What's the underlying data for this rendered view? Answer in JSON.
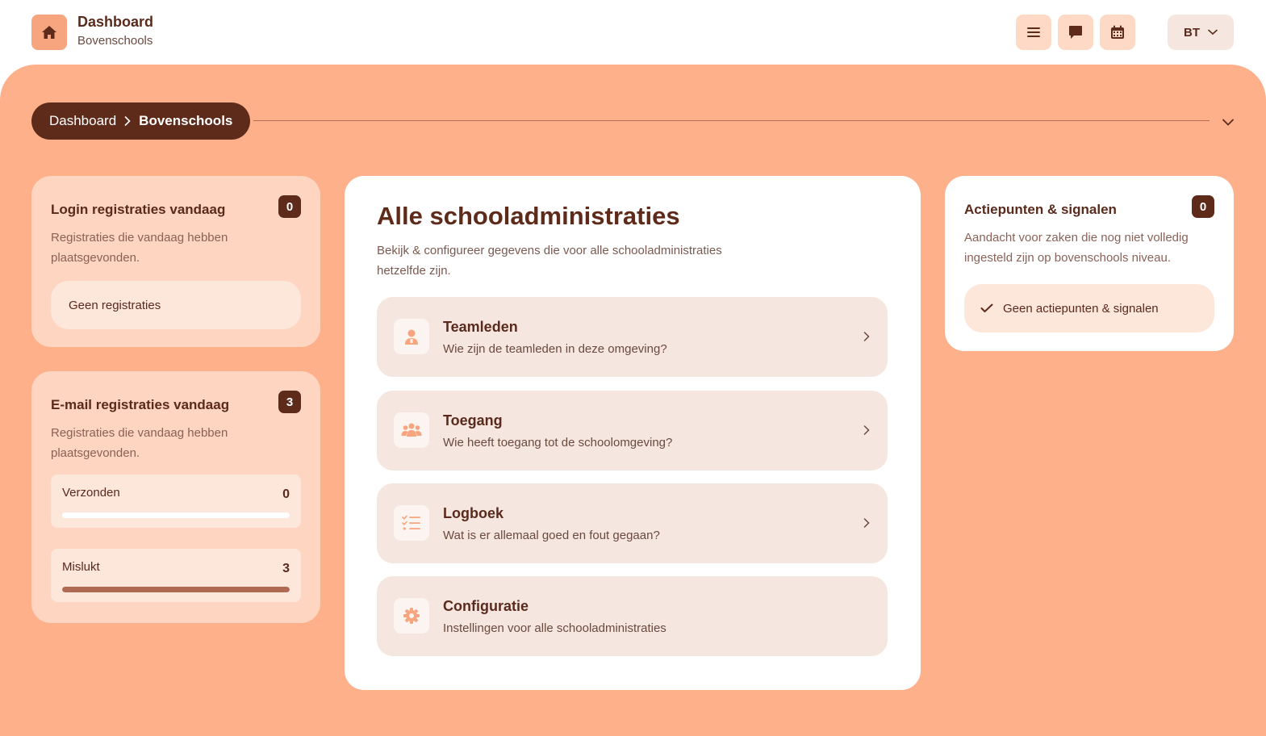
{
  "header": {
    "title": "Dashboard",
    "subtitle": "Bovenschools",
    "user_initials": "BT"
  },
  "breadcrumb": {
    "items": [
      "Dashboard",
      "Bovenschools"
    ]
  },
  "login_card": {
    "title": "Login registraties vandaag",
    "count": "0",
    "description": "Registraties die vandaag hebben plaatsgevonden.",
    "empty_text": "Geen registraties"
  },
  "email_card": {
    "title": "E-mail registraties vandaag",
    "count": "3",
    "description": "Registraties die vandaag hebben plaatsgevonden.",
    "stats": [
      {
        "label": "Verzonden",
        "value": "0",
        "fraction": 0
      },
      {
        "label": "Mislukt",
        "value": "3",
        "fraction": 1
      }
    ]
  },
  "main": {
    "title": "Alle schooladministraties",
    "description": "Bekijk & configureer gegevens die voor alle schooladministraties hetzelfde zijn.",
    "items": [
      {
        "title": "Teamleden",
        "subtitle": "Wie zijn de teamleden in deze omgeving?",
        "icon": "person-icon"
      },
      {
        "title": "Toegang",
        "subtitle": "Wie heeft toegang tot de schoolomgeving?",
        "icon": "users-icon"
      },
      {
        "title": "Logboek",
        "subtitle": "Wat is er allemaal goed en fout gegaan?",
        "icon": "list-check-icon"
      },
      {
        "title": "Configuratie",
        "subtitle": "Instellingen voor alle schooladministraties",
        "icon": "gear-icon"
      }
    ]
  },
  "actions_card": {
    "title": "Actiepunten & signalen",
    "count": "0",
    "description": "Aandacht voor zaken die nog niet volledig ingesteld zijn op bovenschools niveau.",
    "empty_text": "Geen actiepunten & signalen"
  },
  "colors": {
    "accent": "#fdb08a",
    "dark": "#5e2b1b",
    "icon_fill": "#f7a57f"
  }
}
